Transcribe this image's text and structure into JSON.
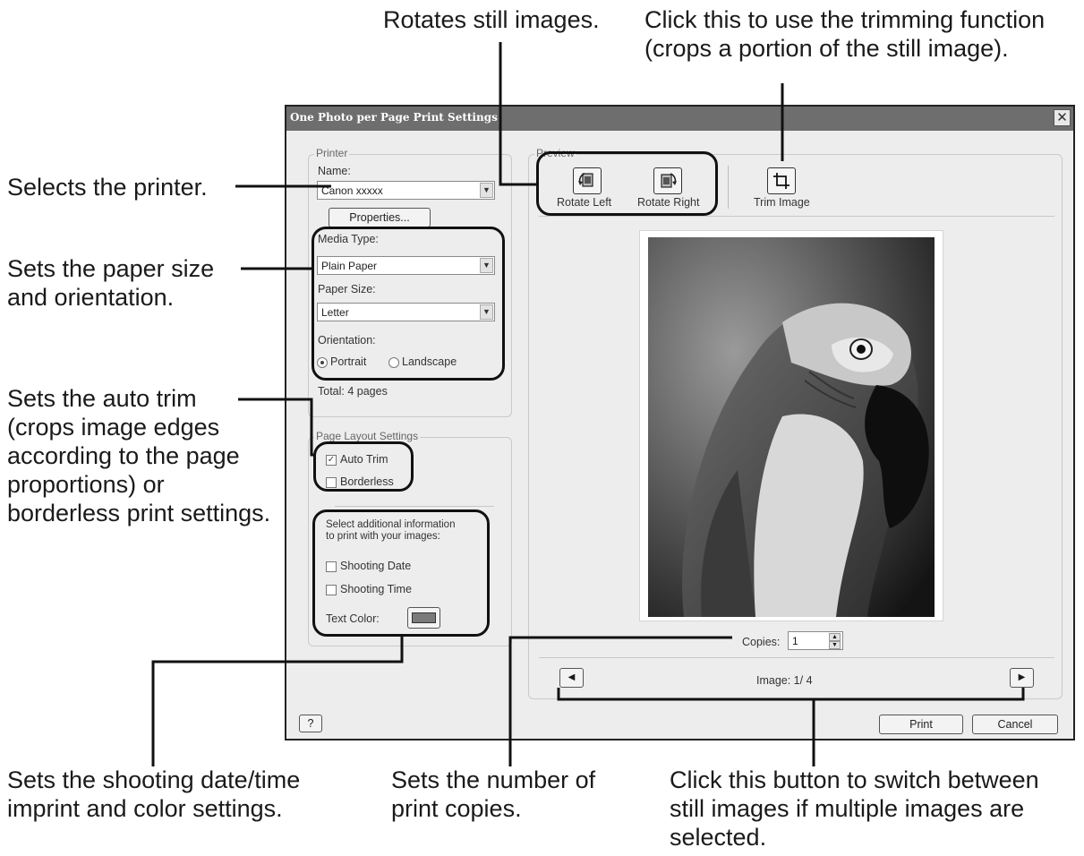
{
  "callouts": {
    "rotate": "Rotates still images.",
    "trim": "Click this to use the trimming function\n(crops a portion of the still image).",
    "printer": "Selects the printer.",
    "paper": "Sets the paper size\nand orientation.",
    "autotrim": "Sets the auto trim\n(crops image edges\naccording to the page\nproportions) or\nborderless print settings.",
    "imprint": "Sets the shooting date/time\nimprint and color settings.",
    "copies": "Sets the number of\nprint copies.",
    "nav": "Click this button to switch between\nstill images if multiple images are\nselected."
  },
  "dialog": {
    "title": "One Photo per Page Print Settings",
    "close_glyph": "✕",
    "help_label": "?",
    "print_label": "Print",
    "cancel_label": "Cancel"
  },
  "printer_group": {
    "title": "Printer",
    "name_label": "Name:",
    "name_value": "Canon xxxxx",
    "properties_label": "Properties...",
    "media_type_label": "Media Type:",
    "media_type_value": "Plain Paper",
    "paper_size_label": "Paper Size:",
    "paper_size_value": "Letter",
    "orientation_label": "Orientation:",
    "orientation_options": [
      "Portrait",
      "Landscape"
    ],
    "orientation_selected": "Portrait",
    "total": "Total: 4 pages"
  },
  "layout_group": {
    "title": "Page Layout Settings",
    "auto_trim_label": "Auto Trim",
    "auto_trim_checked": true,
    "borderless_label": "Borderless",
    "borderless_checked": false,
    "info_text": "Select additional information\nto print with your images:",
    "shooting_date_label": "Shooting Date",
    "shooting_date_checked": false,
    "shooting_time_label": "Shooting Time",
    "shooting_time_checked": false,
    "text_color_label": "Text Color:",
    "text_color": "#7a7a7a"
  },
  "preview": {
    "title": "Preview",
    "rotate_left_label": "Rotate Left",
    "rotate_right_label": "Rotate Right",
    "trim_image_label": "Trim Image",
    "copies_label": "Copies:",
    "copies_value": "1",
    "image_counter": "Image: 1/ 4",
    "prev_glyph": "◀",
    "next_glyph": "▶"
  },
  "icons": [
    "close-icon",
    "dropdown-arrow-icon",
    "rotate-left-icon",
    "rotate-right-icon",
    "trim-icon",
    "spin-up-icon",
    "spin-down-icon",
    "prev-arrow-icon",
    "next-arrow-icon",
    "checkmark-icon"
  ]
}
